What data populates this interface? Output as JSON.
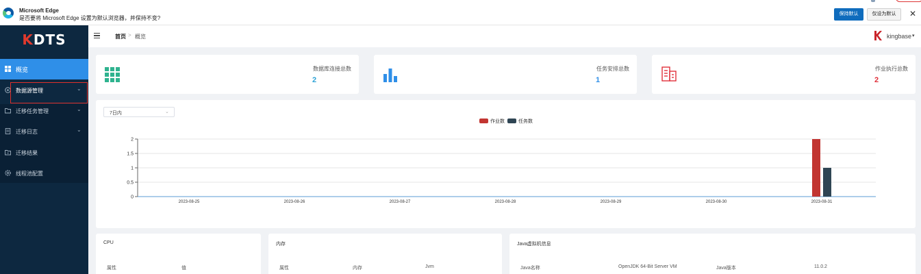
{
  "edge_bar": {
    "title": "Microsoft Edge",
    "message": "是否要将 Microsoft Edge 设置为默认浏览器，并保持不变?",
    "keep_default": "保持默认",
    "only_set_default": "仅设为默认",
    "close_glyph": "✕"
  },
  "sidebar": {
    "logo_k": "K",
    "logo_rest": "DTS",
    "items": [
      {
        "label": "概览",
        "icon": "grid-icon",
        "active": true
      },
      {
        "label": "数据源管理",
        "icon": "database-icon",
        "chevron": "⌄"
      },
      {
        "label": "迁移任务管理",
        "icon": "folder-icon",
        "chevron": "⌄"
      },
      {
        "label": "迁移日志",
        "icon": "document-icon",
        "chevron": "⌄"
      },
      {
        "label": "迁移结果",
        "icon": "result-folder-icon"
      },
      {
        "label": "线程池配置",
        "icon": "gear-icon"
      }
    ]
  },
  "header": {
    "breadcrumb_home": "首页",
    "breadcrumb_sep": ">",
    "breadcrumb_current": "概览",
    "user_name": "kingbase",
    "user_caret": "▾"
  },
  "stats": [
    {
      "label": "数据库连接总数",
      "value": "2",
      "color": "#2ea3d6",
      "icon": "grid-icon"
    },
    {
      "label": "任务安排总数",
      "value": "1",
      "color": "#2f8fe8",
      "icon": "bar-chart-icon"
    },
    {
      "label": "作业执行总数",
      "value": "2",
      "color": "#e0303a",
      "icon": "building-icon"
    }
  ],
  "filter": {
    "value": "7日内",
    "arrow": "⌄"
  },
  "chart_data": {
    "type": "bar",
    "categories": [
      "2023-08-25",
      "2023-08-26",
      "2023-08-27",
      "2023-08-28",
      "2023-08-29",
      "2023-08-30",
      "2023-08-31"
    ],
    "series": [
      {
        "name": "作业数",
        "values": [
          0,
          0,
          0,
          0,
          0,
          0,
          2
        ],
        "color": "#c23531"
      },
      {
        "name": "任务数",
        "values": [
          0,
          0,
          0,
          0,
          0,
          0,
          1
        ],
        "color": "#2f4554"
      }
    ],
    "yticks": [
      "0",
      "0.5",
      "1",
      "1.5",
      "2"
    ],
    "ylim": [
      0,
      2
    ],
    "legend_position": "top-center",
    "grid": true
  },
  "panels": {
    "cpu": {
      "title": "CPU",
      "cols": [
        "属性",
        "值"
      ]
    },
    "memory": {
      "title": "内存",
      "cols": [
        "属性",
        "内存",
        "Jvm"
      ]
    },
    "jvm": {
      "title": "Java虚拟机信息",
      "cols": [
        "Java名称",
        "OpenJDK 64-Bit Server VM",
        "Java版本",
        "11.0.2"
      ]
    }
  }
}
